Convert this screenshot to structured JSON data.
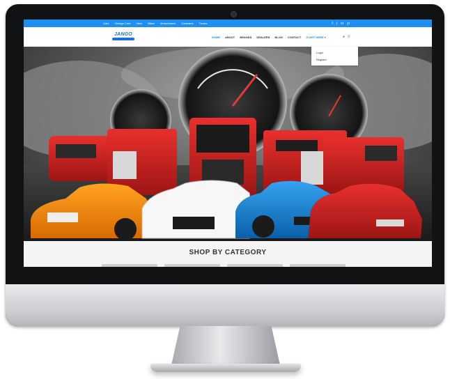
{
  "topbar": {
    "nav": [
      "Cars",
      "Vintage Cars",
      "Vans",
      "Bikes",
      "Motorhomes",
      "Caravans",
      "Trucks"
    ],
    "social": [
      "f",
      "t",
      "in",
      "yt"
    ]
  },
  "header": {
    "logo": "JANGO",
    "logo_sub": "",
    "nav": [
      "HOME",
      "ABOUT",
      "BRANDS",
      "DEALERS",
      "BLOG",
      "CONTACT",
      "START HERE"
    ],
    "icons": [
      "user-icon",
      "search-icon"
    ]
  },
  "dropdown": {
    "items": [
      "Login",
      "Register"
    ]
  },
  "hero": {
    "image": "Red trucks and cars in front of speedometer gauges"
  },
  "category": {
    "title": "SHOP BY CATEGORY"
  },
  "colors": {
    "accent": "#1f8ef1",
    "bezel": "#111214"
  }
}
